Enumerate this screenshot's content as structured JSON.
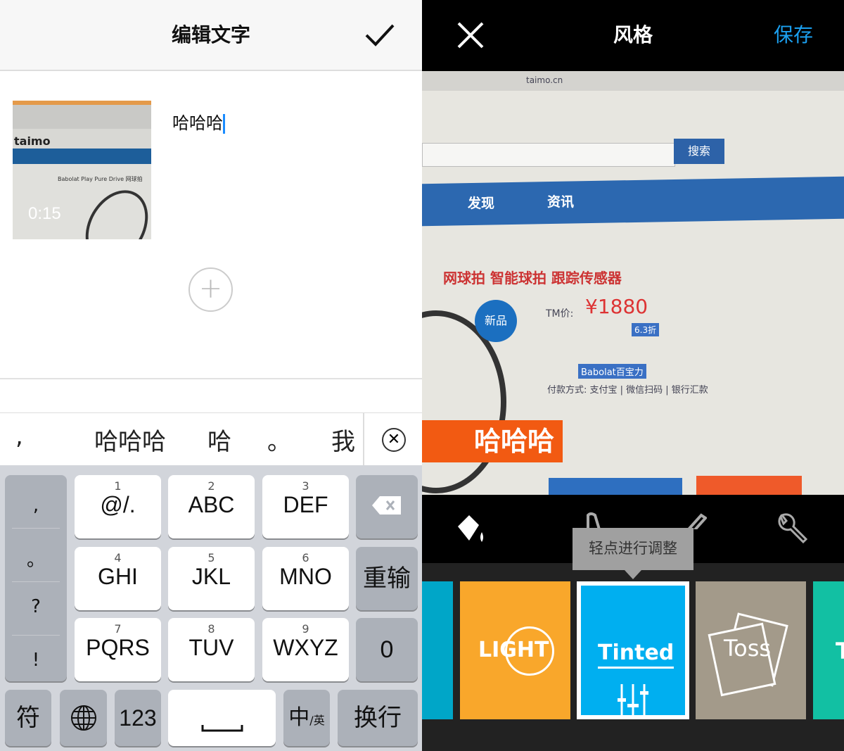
{
  "left_screen": {
    "title": "编辑文字",
    "confirm_icon": "checkmark-icon",
    "video": {
      "duration": "0:15",
      "thumb_brand": "taimo",
      "thumb_product": "Babolat Play Pure Drive 网球拍"
    },
    "text_value": "哈哈哈",
    "add_icon": "plus-circle-icon",
    "candidates": [
      ",",
      "哈哈哈",
      "哈",
      "。",
      "我"
    ],
    "candidate_close_icon": "close-circle-icon",
    "keyboard": {
      "punct": [
        ",",
        "。",
        "?",
        "!"
      ],
      "keys": [
        {
          "num": "1",
          "label": "@/."
        },
        {
          "num": "2",
          "label": "ABC"
        },
        {
          "num": "3",
          "label": "DEF"
        },
        {
          "num": "4",
          "label": "GHI"
        },
        {
          "num": "5",
          "label": "JKL"
        },
        {
          "num": "6",
          "label": "MNO"
        },
        {
          "num": "7",
          "label": "PQRS"
        },
        {
          "num": "8",
          "label": "TUV"
        },
        {
          "num": "9",
          "label": "WXYZ"
        }
      ],
      "delete_icon": "backspace-icon",
      "reenter": "重输",
      "zero": "0",
      "symbols": "符",
      "globe_icon": "globe-icon",
      "numbers": "123",
      "space_icon": "space-icon",
      "lang_main": "中",
      "lang_sub": "/英",
      "return": "换行"
    }
  },
  "right_screen": {
    "close_icon": "close-icon",
    "title": "风格",
    "save": "保存",
    "photo_text": {
      "url": "taimo.cn",
      "search": "搜索",
      "nav1": "发现",
      "nav2": "资讯",
      "headline": "网球拍 智能球拍 跟踪传感器",
      "badge": "新品",
      "price_label": "TM价:",
      "price": "¥1880",
      "discount": "6.3折",
      "brand": "Babolat百宝力",
      "payment": "付款方式: 支付宝 | 微信扫码 | 银行汇款"
    },
    "caption": "哈哈哈",
    "tools": [
      "paint-bucket-icon",
      "font-icon",
      "pencil-icon",
      "wrench-icon"
    ],
    "tooltip": "轻点进行调整",
    "styles": [
      {
        "label": "LIGHT",
        "color": "#f9a72b"
      },
      {
        "label": "Tinted",
        "color": "#00aff0",
        "selected": true
      },
      {
        "label": "Toss",
        "color": "#a39a8a"
      }
    ],
    "edge_left_color": "#00a6c8",
    "edge_right_color": "#12c0a3",
    "edge_right_label": "T"
  }
}
